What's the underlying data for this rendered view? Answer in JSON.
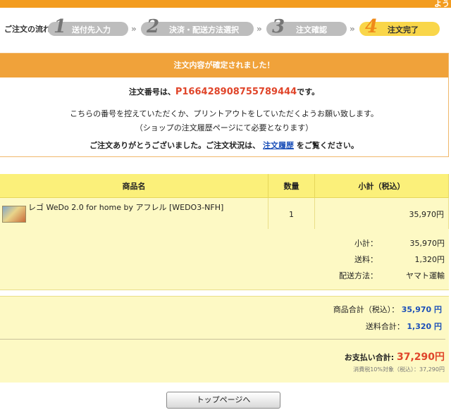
{
  "header": {
    "corner_text": "よう"
  },
  "flow": {
    "label": "ご注文の流れ:",
    "steps": [
      {
        "num": "1",
        "label": "送付先入力"
      },
      {
        "num": "2",
        "label": "決済・配送方法選択"
      },
      {
        "num": "3",
        "label": "注文確認"
      },
      {
        "num": "4",
        "label": "注文完了"
      }
    ],
    "separator": "»"
  },
  "confirmation": {
    "title": "注文内容が確定されました！",
    "order_prefix": "注文番号は、",
    "order_number": "P166428908755789444",
    "order_suffix": "です。",
    "message1": "こちらの番号を控えていただくか、プリントアウトをしていただくようお願い致します。",
    "message2": "（ショップの注文履歴ページにて必要となります）",
    "message3_prefix": "ご注文ありがとうございました。ご注文状況は、",
    "history_link": "注文履歴",
    "message3_suffix": "をご覧ください。"
  },
  "items_table": {
    "headers": {
      "name": "商品名",
      "qty": "数量",
      "subtotal": "小計（税込）"
    },
    "rows": [
      {
        "name": "レゴ WeDo 2.0 for home by アフレル [WEDO3-NFH]",
        "qty": "1",
        "subtotal": "35,970円"
      }
    ]
  },
  "summary": {
    "subtotal_label": "小計：",
    "subtotal_value": "35,970円",
    "shipping_label": "送料：",
    "shipping_value": "1,320円",
    "method_label": "配送方法：",
    "method_value": "ヤマト運輸"
  },
  "totals": {
    "goods_label": "商品合計（税込）：",
    "goods_value": "35,970 円",
    "shipping_label": "送料合計：",
    "shipping_value": "1,320 円",
    "payment_label": "お支払い合計:",
    "payment_value": "37,290円",
    "tax_note": "消費税10%対象（税込）：37,290円"
  },
  "footer": {
    "top_button": "トップページへ"
  },
  "colors": {
    "accent": "#f0a23a",
    "order_number": "#e0452a",
    "link": "#1b4fb8",
    "table_head": "#fbf07a",
    "table_body": "#fdf9c4"
  }
}
